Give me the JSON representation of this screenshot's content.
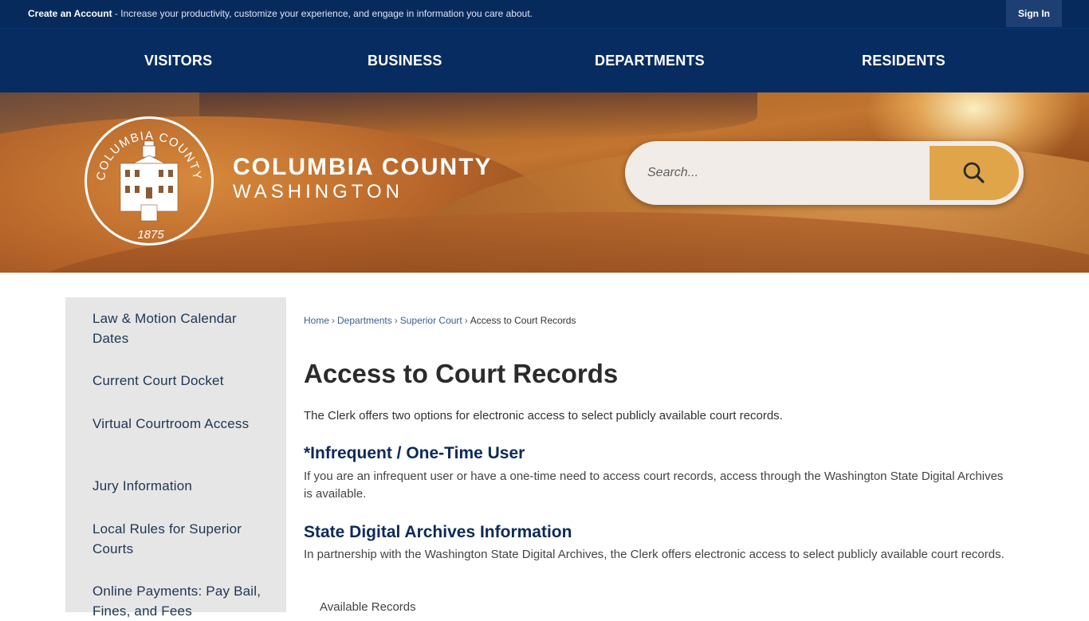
{
  "topbar": {
    "create_account_label": "Create an Account",
    "promo_text": " - Increase your productivity, customize your experience, and engage in information you care about.",
    "signin_label": "Sign In"
  },
  "nav": {
    "items": [
      "VISITORS",
      "BUSINESS",
      "DEPARTMENTS",
      "RESIDENTS"
    ]
  },
  "banner": {
    "seal_top_text": "COLUMBIA COUNTY",
    "seal_year": "1875",
    "brand_line1": "COLUMBIA COUNTY",
    "brand_line2": "WASHINGTON",
    "search_placeholder": "Search..."
  },
  "sidebar": {
    "items": [
      "Law & Motion Calendar Dates",
      "Current Court Docket",
      "Virtual Courtroom Access",
      "Jury Information",
      "Local Rules for Superior Courts",
      "Online Payments: Pay Bail, Fines, and Fees"
    ]
  },
  "breadcrumb": {
    "items": [
      "Home",
      "Departments",
      "Superior Court"
    ],
    "current": "Access to Court Records",
    "separator": "›"
  },
  "content": {
    "title": "Access to Court Records",
    "intro": "The Clerk offers two options for electronic access to select publicly available court records.",
    "sections": [
      {
        "heading": "*Infrequent / One-Time User",
        "body": "If you are an infrequent user or have a one-time need to access court records, access through the Washington State Digital Archives is available."
      },
      {
        "heading": "State Digital Archives Information",
        "body": "In partnership with the Washington State Digital Archives, the Clerk offers electronic access to select publicly available court records."
      }
    ],
    "available_records_label": "Available Records"
  },
  "colors": {
    "topbar_bg": "#062a5c",
    "nav_bg": "#062c62",
    "accent_gold": "#e0a548",
    "heading_navy": "#0d2a58",
    "sidebar_bg": "#e6e6e6"
  }
}
